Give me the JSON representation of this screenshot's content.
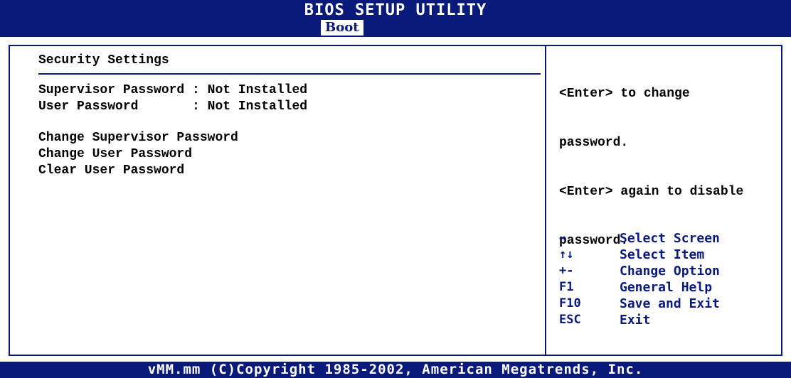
{
  "header": {
    "app_title": "BIOS SETUP UTILITY",
    "active_tab": "Boot"
  },
  "main": {
    "section_title": "Security Settings",
    "status": [
      {
        "label": "Supervisor Password : Not Installed"
      },
      {
        "label": "User Password       : Not Installed"
      }
    ],
    "menu_items": [
      "Change Supervisor Password",
      "Change User Password",
      "Clear User Password"
    ]
  },
  "help": {
    "lines": [
      "<Enter> to change",
      "password.",
      "<Enter> again to disable",
      "password."
    ],
    "keys": [
      {
        "key": "↔",
        "desc": "Select Screen",
        "icon": "left-right-arrow-icon"
      },
      {
        "key": "↑↓",
        "desc": "Select Item",
        "icon": "up-down-arrow-icon"
      },
      {
        "key": "+-",
        "desc": "Change Option",
        "icon": "plus-minus-icon"
      },
      {
        "key": "F1",
        "desc": "General Help",
        "icon": ""
      },
      {
        "key": "F10",
        "desc": "Save and Exit",
        "icon": ""
      },
      {
        "key": "ESC",
        "desc": "Exit",
        "icon": ""
      }
    ]
  },
  "footer": {
    "copyright": "vMM.mm (C)Copyright 1985-2002, American Megatrends, Inc."
  },
  "colors": {
    "bar_blue": "#0a1a7a",
    "text": "#000000",
    "background": "#ffffff"
  }
}
